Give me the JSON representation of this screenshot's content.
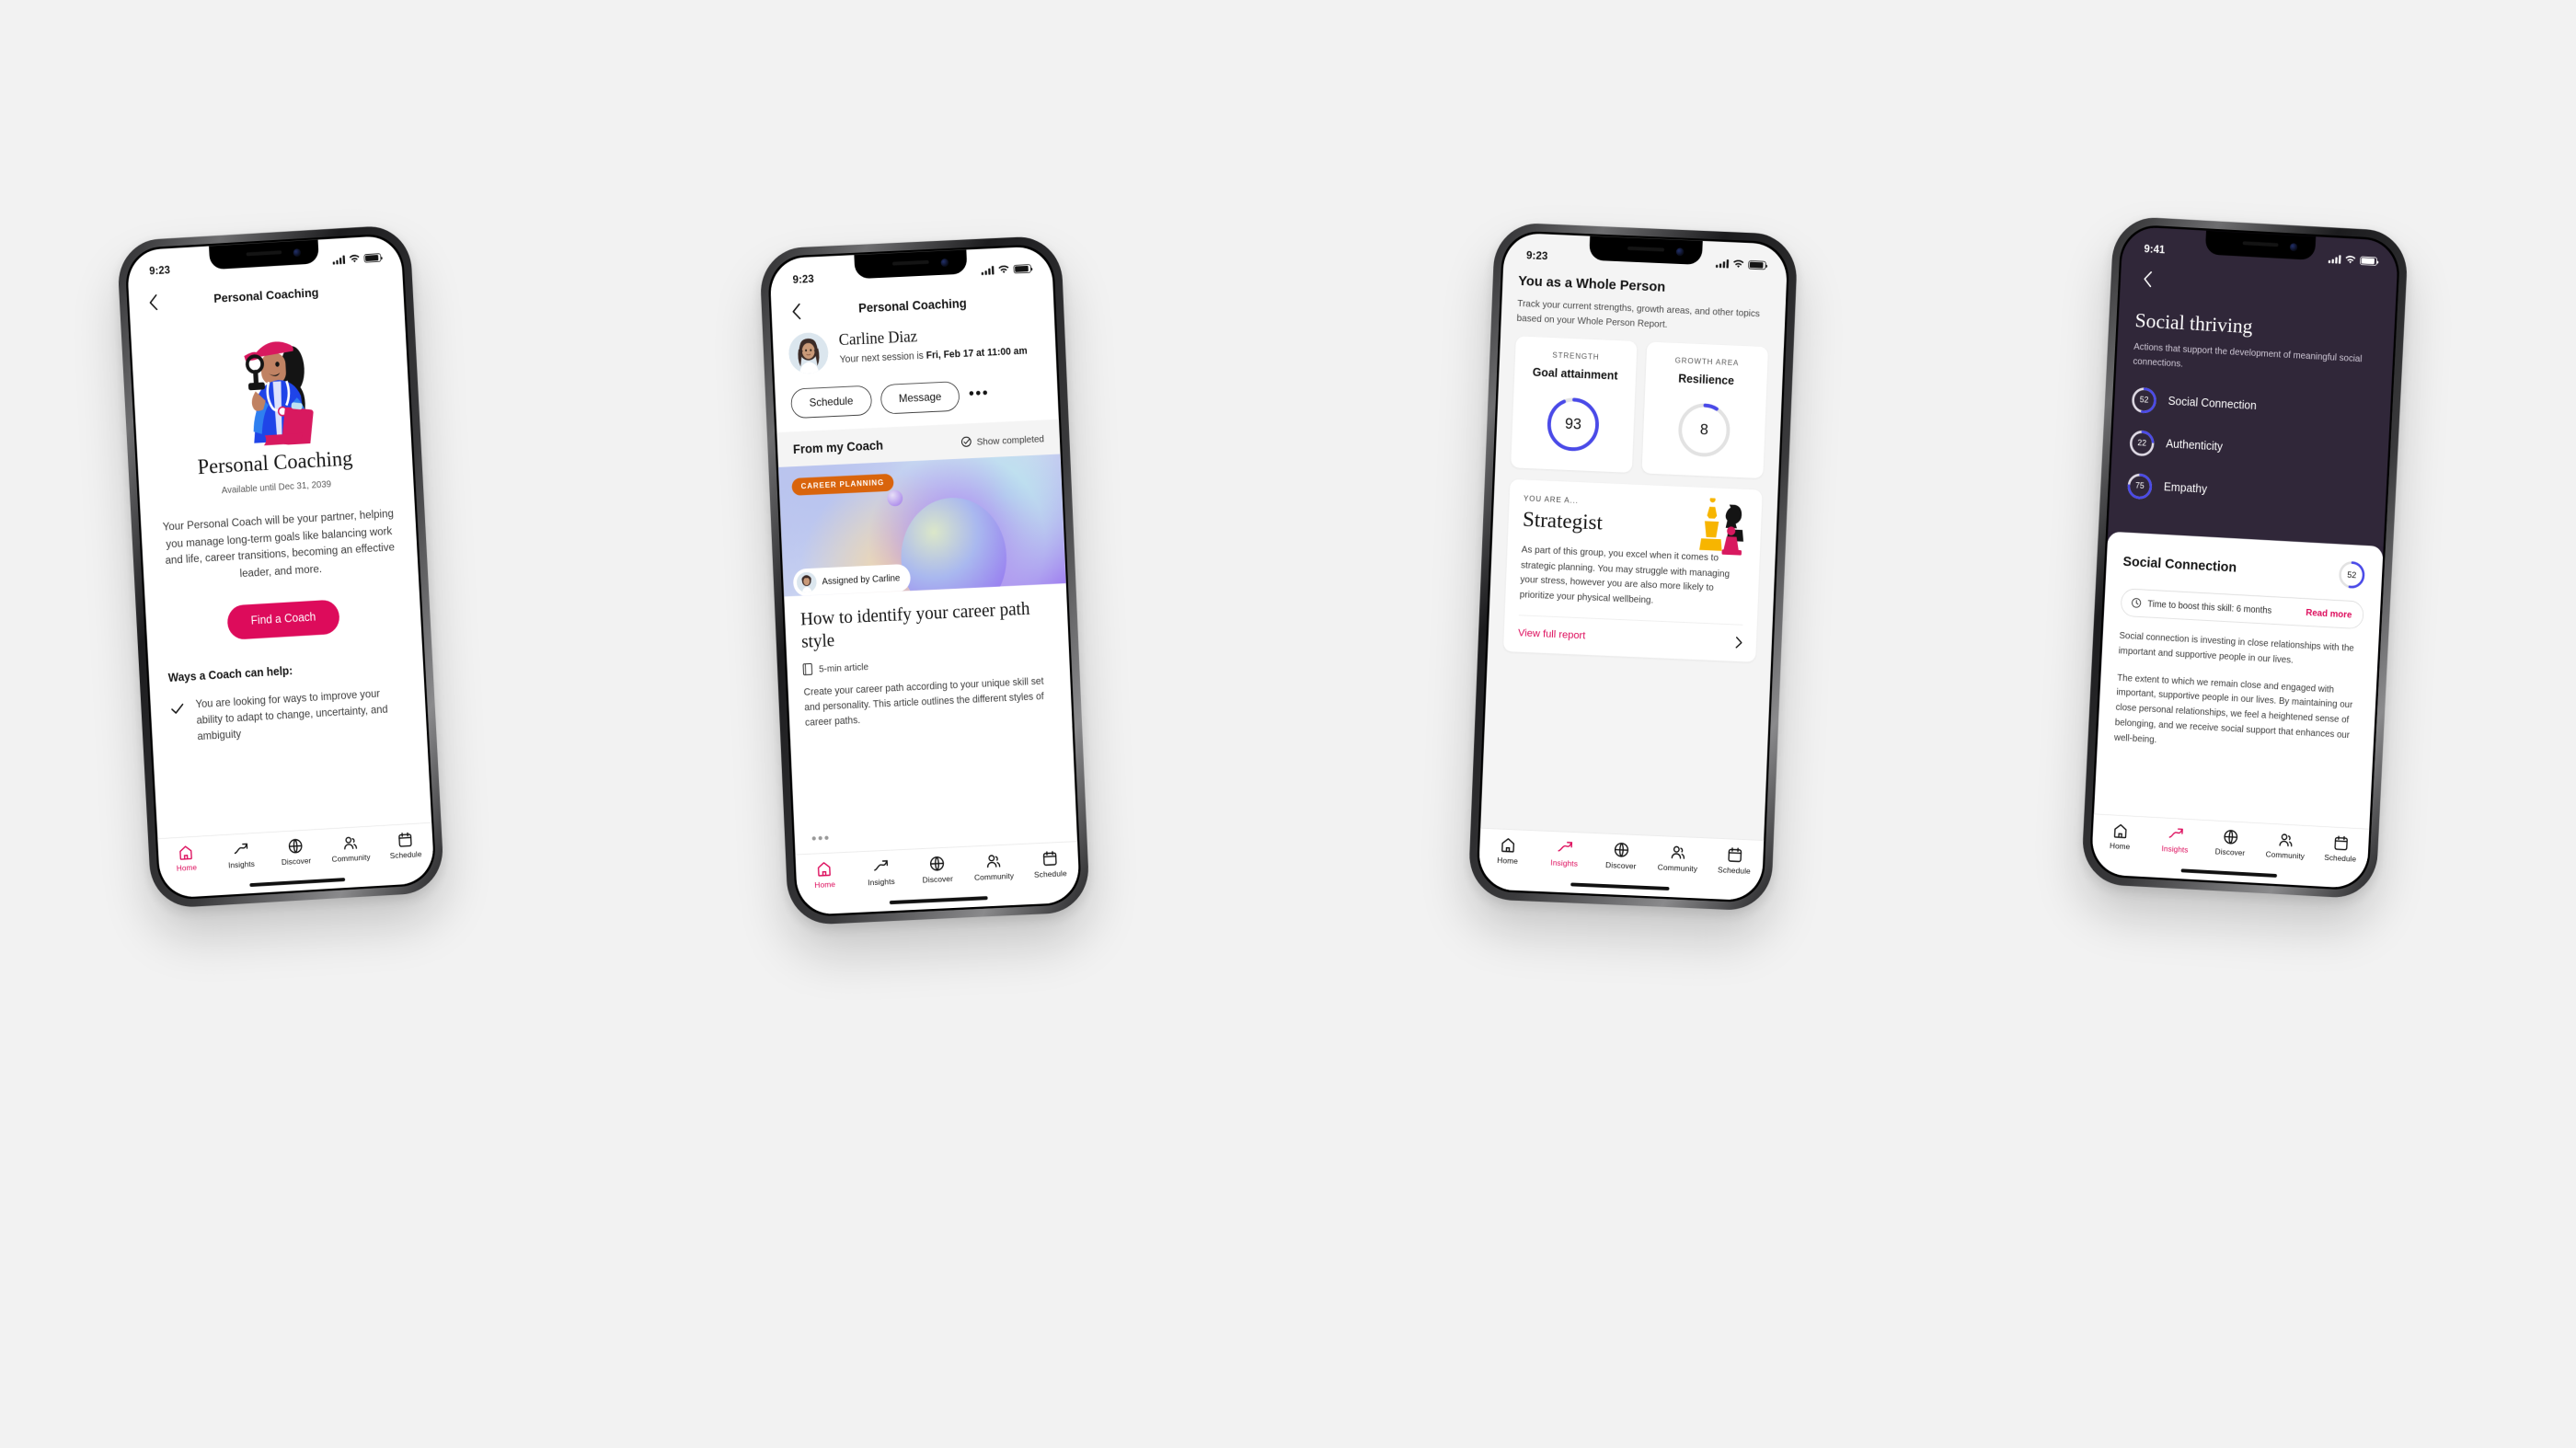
{
  "colors": {
    "brand_pink": "#dd0b5b",
    "accent_blue": "#4a4ae8",
    "chip_orange": "#d9640c",
    "dark_bg": "#302739",
    "page_bg": "#f2f2f2"
  },
  "tabs": [
    {
      "label": "Home",
      "icon": "home-icon"
    },
    {
      "label": "Insights",
      "icon": "trend-up-icon"
    },
    {
      "label": "Discover",
      "icon": "globe-icon"
    },
    {
      "label": "Community",
      "icon": "people-icon"
    },
    {
      "label": "Schedule",
      "icon": "calendar-icon"
    }
  ],
  "phone1": {
    "status": {
      "time": "9:23"
    },
    "nav": {
      "title": "Personal Coaching",
      "back_icon": "chevron-left-icon"
    },
    "illustration": "coach-illustration",
    "heading": "Personal Coaching",
    "availability": "Available until Dec 31, 2039",
    "blurb": "Your Personal Coach will be your partner, helping you manage long-term goals like balancing work and life, career transitions, becoming an effective leader, and more.",
    "cta_label": "Find a Coach",
    "ways_heading": "Ways a Coach can help:",
    "ways": [
      {
        "icon": "check-icon",
        "text": "You are looking for ways to improve your ability to adapt to change, uncertainty, and ambiguity"
      }
    ],
    "active_tab": "Home"
  },
  "phone2": {
    "status": {
      "time": "9:23"
    },
    "nav": {
      "title": "Personal Coaching",
      "back_icon": "chevron-left-icon"
    },
    "coach": {
      "avatar": "coach-avatar",
      "name": "Carline Diaz",
      "next_session_prefix": "Your next session is ",
      "next_session_value": "Fri, Feb 17 at 11:00 am"
    },
    "actions": {
      "schedule": "Schedule",
      "message": "Message",
      "more_icon": "more-horizontal-icon"
    },
    "section": {
      "title": "From my Coach",
      "toggle_label": "Show completed",
      "toggle_icon": "check-circle-icon"
    },
    "article": {
      "chip": "CAREER PLANNING",
      "assigned_by": "Assigned by Carline",
      "assigned_avatar": "coach-avatar-small",
      "title": "How to identify your career path style",
      "meta_icon": "book-icon",
      "meta": "5-min article",
      "description": "Create your career path according to your unique skill set and personality. This article outlines the different styles of career paths."
    },
    "active_tab": "Home"
  },
  "phone3": {
    "status": {
      "time": "9:23"
    },
    "section": {
      "title": "You as a Whole Person",
      "description": "Track your current strengths, growth areas, and other topics based on your Whole Person Report."
    },
    "metrics": [
      {
        "kind": "STRENGTH",
        "name": "Goal attainment",
        "value": 93
      },
      {
        "kind": "GROWTH AREA",
        "name": "Resilience",
        "value": 8
      }
    ],
    "persona": {
      "eyebrow": "YOU ARE A...",
      "name": "Strategist",
      "icon": "chess-pieces-icon",
      "description": "As part of this group, you excel when it comes to strategic planning. You may struggle with managing your stress, however you are also more likely to prioritize your physical wellbeing.",
      "link_label": "View full report",
      "link_icon": "chevron-right-icon"
    },
    "active_tab": "Insights"
  },
  "phone4": {
    "status": {
      "time": "9:41"
    },
    "nav": {
      "back_icon": "chevron-left-icon"
    },
    "title": "Social thriving",
    "subtitle": "Actions that support the development of meaningful social connections.",
    "items": [
      {
        "value": 52,
        "label": "Social Connection"
      },
      {
        "value": 22,
        "label": "Authenticity"
      },
      {
        "value": 75,
        "label": "Empathy"
      }
    ],
    "detail": {
      "title": "Social Connection",
      "score": 52,
      "boost_icon": "clock-icon",
      "boost_label": "Time to boost this skill: 6 months",
      "read_more": "Read more",
      "paragraph1": "Social connection is investing in close relationships with the important and supportive people in our lives.",
      "paragraph2": "The extent to which we remain close and engaged with important, supportive people in our lives. By maintaining our close personal relationships, we feel a heightened sense of belonging, and we receive social support that enhances our well-being."
    },
    "active_tab": "Insights"
  },
  "chart_data": [
    {
      "type": "pie",
      "title": "Goal attainment",
      "categories": [
        "filled",
        "remaining"
      ],
      "values": [
        93,
        7
      ],
      "ylim": [
        0,
        100
      ]
    },
    {
      "type": "pie",
      "title": "Resilience",
      "categories": [
        "filled",
        "remaining"
      ],
      "values": [
        8,
        92
      ],
      "ylim": [
        0,
        100
      ]
    },
    {
      "type": "pie",
      "title": "Social Connection",
      "categories": [
        "filled",
        "remaining"
      ],
      "values": [
        52,
        48
      ],
      "ylim": [
        0,
        100
      ]
    },
    {
      "type": "pie",
      "title": "Authenticity",
      "categories": [
        "filled",
        "remaining"
      ],
      "values": [
        22,
        78
      ],
      "ylim": [
        0,
        100
      ]
    },
    {
      "type": "pie",
      "title": "Empathy",
      "categories": [
        "filled",
        "remaining"
      ],
      "values": [
        75,
        25
      ],
      "ylim": [
        0,
        100
      ]
    }
  ]
}
